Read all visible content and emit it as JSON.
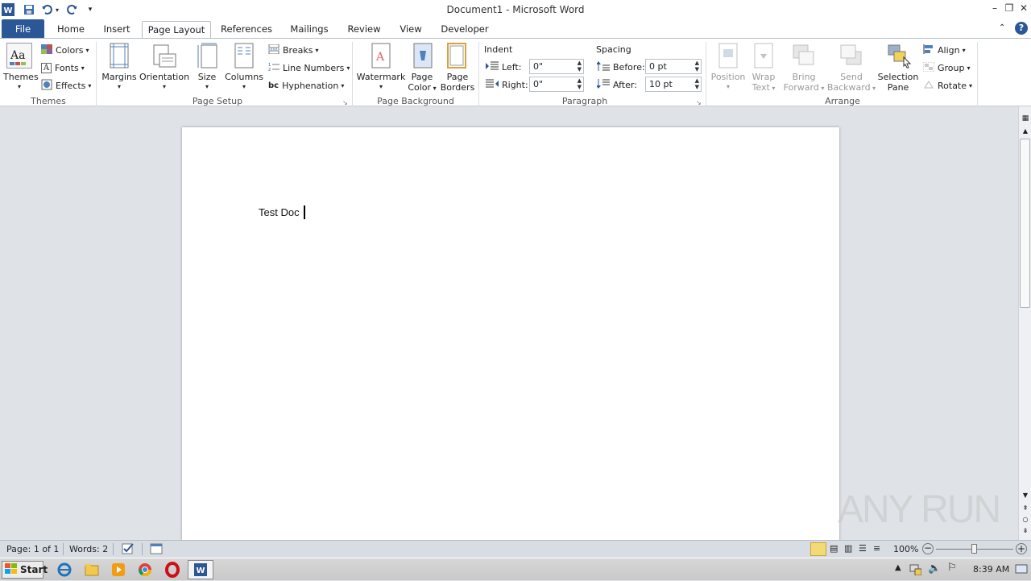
{
  "window": {
    "title": "Document1 - Microsoft Word",
    "controls": {
      "minimize": "–",
      "restore": "❐",
      "close": "✕"
    }
  },
  "tabs": [
    {
      "label": "File"
    },
    {
      "label": "Home"
    },
    {
      "label": "Insert"
    },
    {
      "label": "Page Layout",
      "active": true
    },
    {
      "label": "References"
    },
    {
      "label": "Mailings"
    },
    {
      "label": "Review"
    },
    {
      "label": "View"
    },
    {
      "label": "Developer"
    }
  ],
  "ribbon": {
    "themes": {
      "group_label": "Themes",
      "themes_label": "Themes",
      "colors_label": "Colors",
      "fonts_label": "Fonts",
      "effects_label": "Effects"
    },
    "page_setup": {
      "group_label": "Page Setup",
      "margins_label": "Margins",
      "orientation_label": "Orientation",
      "size_label": "Size",
      "columns_label": "Columns",
      "breaks_label": "Breaks",
      "line_numbers_label": "Line Numbers",
      "hyphenation_label": "Hyphenation"
    },
    "page_background": {
      "group_label": "Page Background",
      "watermark_label": "Watermark",
      "page_color_label_1": "Page",
      "page_color_label_2": "Color",
      "page_borders_label_1": "Page",
      "page_borders_label_2": "Borders"
    },
    "paragraph": {
      "group_label": "Paragraph",
      "indent_label": "Indent",
      "left_label": "Left:",
      "left_value": "0\"",
      "right_label": "Right:",
      "right_value": "0\"",
      "spacing_label": "Spacing",
      "before_label": "Before:",
      "before_value": "0 pt",
      "after_label": "After:",
      "after_value": "10 pt"
    },
    "arrange": {
      "group_label": "Arrange",
      "position_label": "Position",
      "wrap_text_label_1": "Wrap",
      "wrap_text_label_2": "Text",
      "bring_forward_label_1": "Bring",
      "bring_forward_label_2": "Forward",
      "send_backward_label_1": "Send",
      "send_backward_label_2": "Backward",
      "selection_pane_label_1": "Selection",
      "selection_pane_label_2": "Pane",
      "align_label": "Align",
      "group_btn_label": "Group",
      "rotate_label": "Rotate"
    }
  },
  "document": {
    "text": "Test Doc"
  },
  "status": {
    "page": "Page: 1 of 1",
    "words": "Words: 2",
    "zoom": "100%"
  },
  "taskbar": {
    "start_label": "Start",
    "time": "8:39 AM"
  },
  "watermark": "ANY RUN",
  "colors": {
    "file_tab": "#2b5797",
    "workspace": "#dfe3e8"
  }
}
